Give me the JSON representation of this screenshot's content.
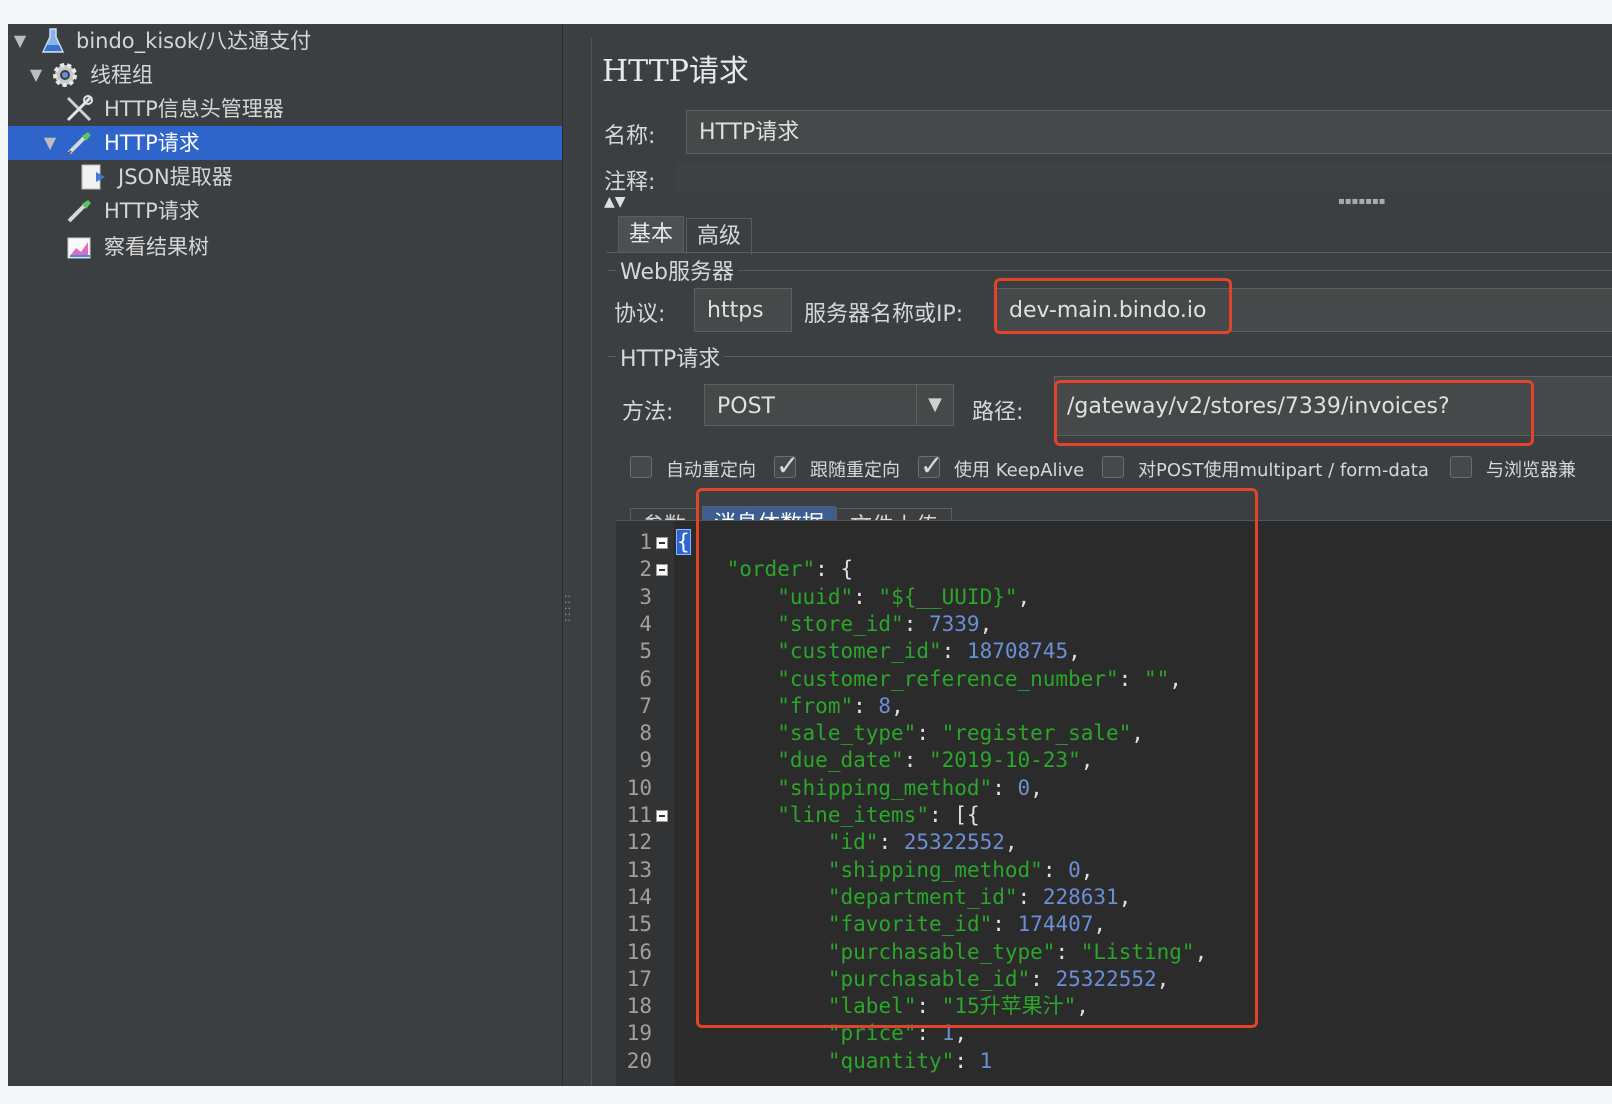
{
  "tree": {
    "items": [
      {
        "label": "bindo_kisok/八达通支付",
        "icon": "flask-icon"
      },
      {
        "label": "线程组",
        "icon": "gear-icon"
      },
      {
        "label": "HTTP信息头管理器",
        "icon": "tools-icon"
      },
      {
        "label": "HTTP请求",
        "icon": "pipette-icon"
      },
      {
        "label": "JSON提取器",
        "icon": "extractor-icon"
      },
      {
        "label": "HTTP请求",
        "icon": "pipette-icon"
      },
      {
        "label": "察看结果树",
        "icon": "chart-icon"
      }
    ]
  },
  "panel": {
    "title": "HTTP请求",
    "name_label": "名称:",
    "name_value": "HTTP请求",
    "comment_label": "注释:",
    "comment_value": "",
    "tabs": [
      "基本",
      "高级"
    ],
    "web_server_group": "Web服务器",
    "protocol_label": "协议:",
    "protocol_value": "https",
    "server_label": "服务器名称或IP:",
    "server_value": "dev-main.bindo.io",
    "http_group": "HTTP请求",
    "method_label": "方法:",
    "method_value": "POST",
    "path_label": "路径:",
    "path_value": "/gateway/v2/stores/7339/invoices?",
    "checkboxes": [
      {
        "label": "自动重定向",
        "checked": false
      },
      {
        "label": "跟随重定向",
        "checked": true
      },
      {
        "label": "使用 KeepAlive",
        "checked": true
      },
      {
        "label": "对POST使用multipart / form-data",
        "checked": false
      },
      {
        "label": "与浏览器兼",
        "checked": false
      }
    ],
    "body_tabs": [
      "参数",
      "消息体数据",
      "文件上传"
    ]
  },
  "editor": {
    "line_numbers": [
      "1",
      "2",
      "3",
      "4",
      "5",
      "6",
      "7",
      "8",
      "9",
      "10",
      "11",
      "12",
      "13",
      "14",
      "15",
      "16",
      "17",
      "18",
      "19",
      "20"
    ],
    "lines": [
      "{",
      "    \"order\": {",
      "        \"uuid\": \"${__UUID}\",",
      "        \"store_id\": 7339,",
      "        \"customer_id\": 18708745,",
      "        \"customer_reference_number\": \"\",",
      "        \"from\": 8,",
      "        \"sale_type\": \"register_sale\",",
      "        \"due_date\": \"2019-10-23\",",
      "        \"shipping_method\": 0,",
      "        \"line_items\": [{",
      "            \"id\": 25322552,",
      "            \"shipping_method\": 0,",
      "            \"department_id\": 228631,",
      "            \"favorite_id\": 174407,",
      "            \"purchasable_type\": \"Listing\",",
      "            \"purchasable_id\": 25322552,",
      "            \"label\": \"15升苹果汁\",",
      "            \"price\": 1,",
      "            \"quantity\": 1"
    ]
  },
  "colors": {
    "highlight": "#e0442a",
    "selection": "#2f65ca",
    "json_key": "#2ba62b",
    "json_number": "#6b8fd6"
  }
}
